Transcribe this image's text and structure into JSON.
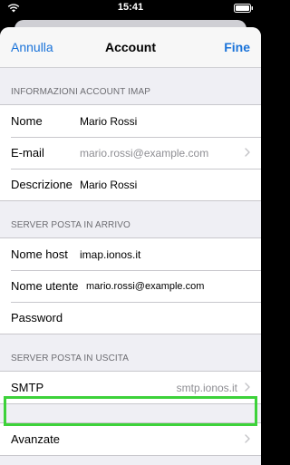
{
  "status_bar": {
    "time": "15:41"
  },
  "nav": {
    "cancel_label": "Annulla",
    "title": "Account",
    "done_label": "Fine"
  },
  "sections": {
    "imap_header": "INFORMAZIONI ACCOUNT IMAP",
    "incoming_header": "SERVER POSTA IN ARRIVO",
    "outgoing_header": "SERVER POSTA IN USCITA"
  },
  "imap": {
    "name_label": "Nome",
    "name_value": "Mario Rossi",
    "email_label": "E-mail",
    "email_value": "mario.rossi@example.com",
    "description_label": "Descrizione",
    "description_value": "Mario Rossi"
  },
  "incoming": {
    "host_label": "Nome host",
    "host_value": "imap.ionos.it",
    "username_label": "Nome utente",
    "username_value": "mario.rossi@example.com",
    "password_label": "Password",
    "password_value": ""
  },
  "outgoing": {
    "smtp_label": "SMTP",
    "smtp_value": "smtp.ionos.it"
  },
  "advanced": {
    "label": "Avanzate"
  },
  "colors": {
    "accent": "#1a73d9",
    "highlight": "#3dd23a",
    "background": "#efeff4"
  },
  "icons": {
    "status_left": "wifi-icon",
    "status_right": "battery-icon",
    "disclosure": "chevron-right-icon"
  }
}
